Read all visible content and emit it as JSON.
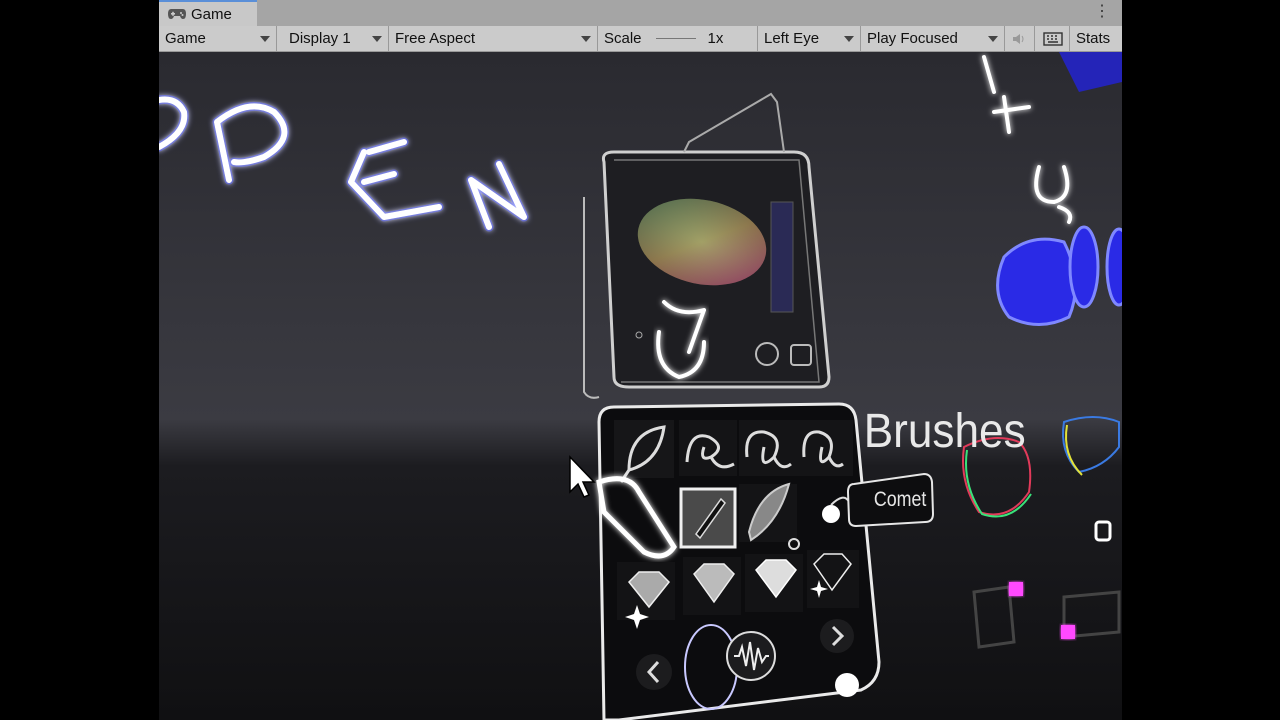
{
  "tab": {
    "label": "Game",
    "icon": "gamepad-icon"
  },
  "toolbar": {
    "display_mode": "Game",
    "display": "Display 1",
    "aspect": "Free Aspect",
    "scale_label": "Scale",
    "scale_value": "1x",
    "eye": "Left Eye",
    "play_mode": "Play Focused",
    "stats": "Stats"
  },
  "scene": {
    "panel_title": "Brushes",
    "tooltip": "Comet",
    "accent_color": "#4a5cff",
    "ink_color": "#ffffff"
  }
}
